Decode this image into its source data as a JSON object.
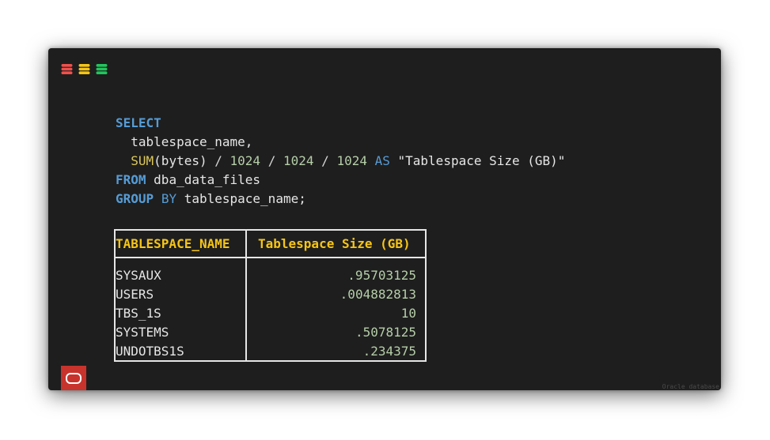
{
  "window": {
    "light_icons": [
      "database-red-icon",
      "database-yellow-icon",
      "database-green-icon"
    ],
    "light_colors": [
      "#f0504c",
      "#f5c518",
      "#22c55e"
    ]
  },
  "code": {
    "l1_kw": "SELECT",
    "l2_col": "tablespace_name,",
    "l3_fn": "SUM",
    "l3_arg": "(bytes)",
    "l3_div": "/",
    "l3_num": "1024",
    "l3_as": "AS",
    "l3_alias": "\"Tablespace Size (GB)\"",
    "l4_kw": "FROM",
    "l4_table": "dba_data_files",
    "l5_kw1": "GROUP",
    "l5_kw2": "BY",
    "l5_col": "tablespace_name;"
  },
  "result": {
    "headers": [
      "TABLESPACE_NAME",
      "Tablespace Size (GB)"
    ],
    "rows": [
      {
        "name": "SYSAUX",
        "value": ".95703125"
      },
      {
        "name": "USERS",
        "value": ".004882813"
      },
      {
        "name": "TBS_1S",
        "value": "10"
      },
      {
        "name": "SYSTEMS",
        "value": ".5078125"
      },
      {
        "name": "UNDOTBS1S",
        "value": ".234375"
      }
    ]
  },
  "footer": {
    "logo_icon": "oracle-logo-icon",
    "logo_color": "#c8332c",
    "watermark": "Oracle database"
  }
}
